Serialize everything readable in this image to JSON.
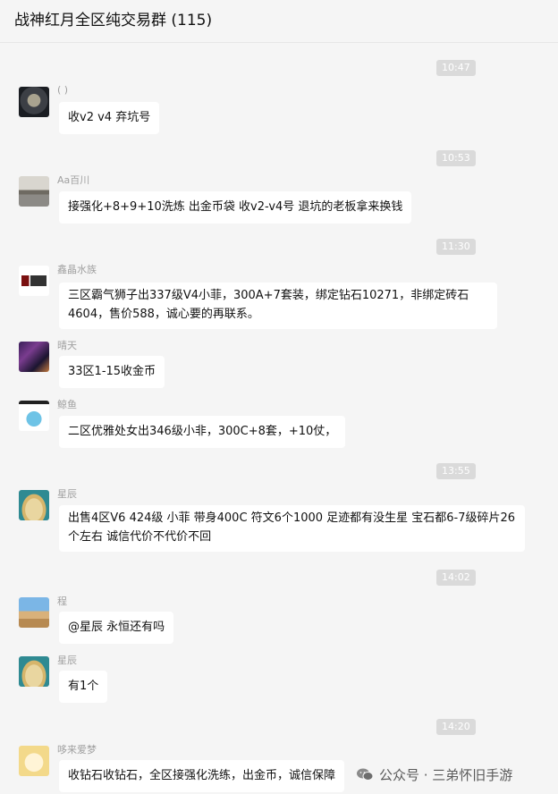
{
  "header": {
    "title": "战神红月全区纯交易群 (115)"
  },
  "timestamps": [
    "10:47",
    "10:53",
    "11:30",
    "13:55",
    "14:02",
    "14:20"
  ],
  "messages": [
    {
      "sender": "(      )",
      "text": "收v2 v4 弃坑号",
      "avatar_icon": "avatar-dark-ring"
    },
    {
      "sender": "Aa百川",
      "text": "接强化+8+9+10洗炼 出金币袋  收v2-v4号 退坑的老板拿来换钱",
      "avatar_icon": "avatar-office"
    },
    {
      "sender": "鑫晶水族",
      "text": "三区霸气狮子出337级V4小菲，300A+7套装，绑定钻石10271，非绑定砖石4604，售价588，诚心要的再联系。",
      "avatar_icon": "avatar-red-logo"
    },
    {
      "sender": "晴天",
      "text": "33区1-15收金币",
      "avatar_icon": "avatar-night"
    },
    {
      "sender": "鲸鱼",
      "text": "二区优雅处女出346级小非，300C+8套，+10仗，",
      "avatar_icon": "avatar-cartoon-whale"
    },
    {
      "sender": "星辰",
      "text": "出售4区V6 424级   小菲 带身400C  符文6个1000   足迹都有没生星 宝石都6-7级碎片26个左右  诚信代价不代价不回",
      "avatar_icon": "avatar-vase"
    },
    {
      "sender": "程",
      "text": "@星辰 永恒还有吗",
      "avatar_icon": "avatar-desert"
    },
    {
      "sender": "星辰",
      "text": "有1个",
      "avatar_icon": "avatar-vase"
    },
    {
      "sender": "哆来爱梦",
      "text": "收钻石收钻石，全区接强化洗练，出金币，诚信保障",
      "avatar_icon": "avatar-cartoon-cat"
    }
  ],
  "watermark": {
    "text": "公众号 · 三弟怀旧手游",
    "icon": "wechat-icon"
  },
  "colors": {
    "background": "#f5f5f5",
    "bubble": "#ffffff",
    "timestamp_bg": "#dadada",
    "sender_text": "#a0a0a0"
  }
}
